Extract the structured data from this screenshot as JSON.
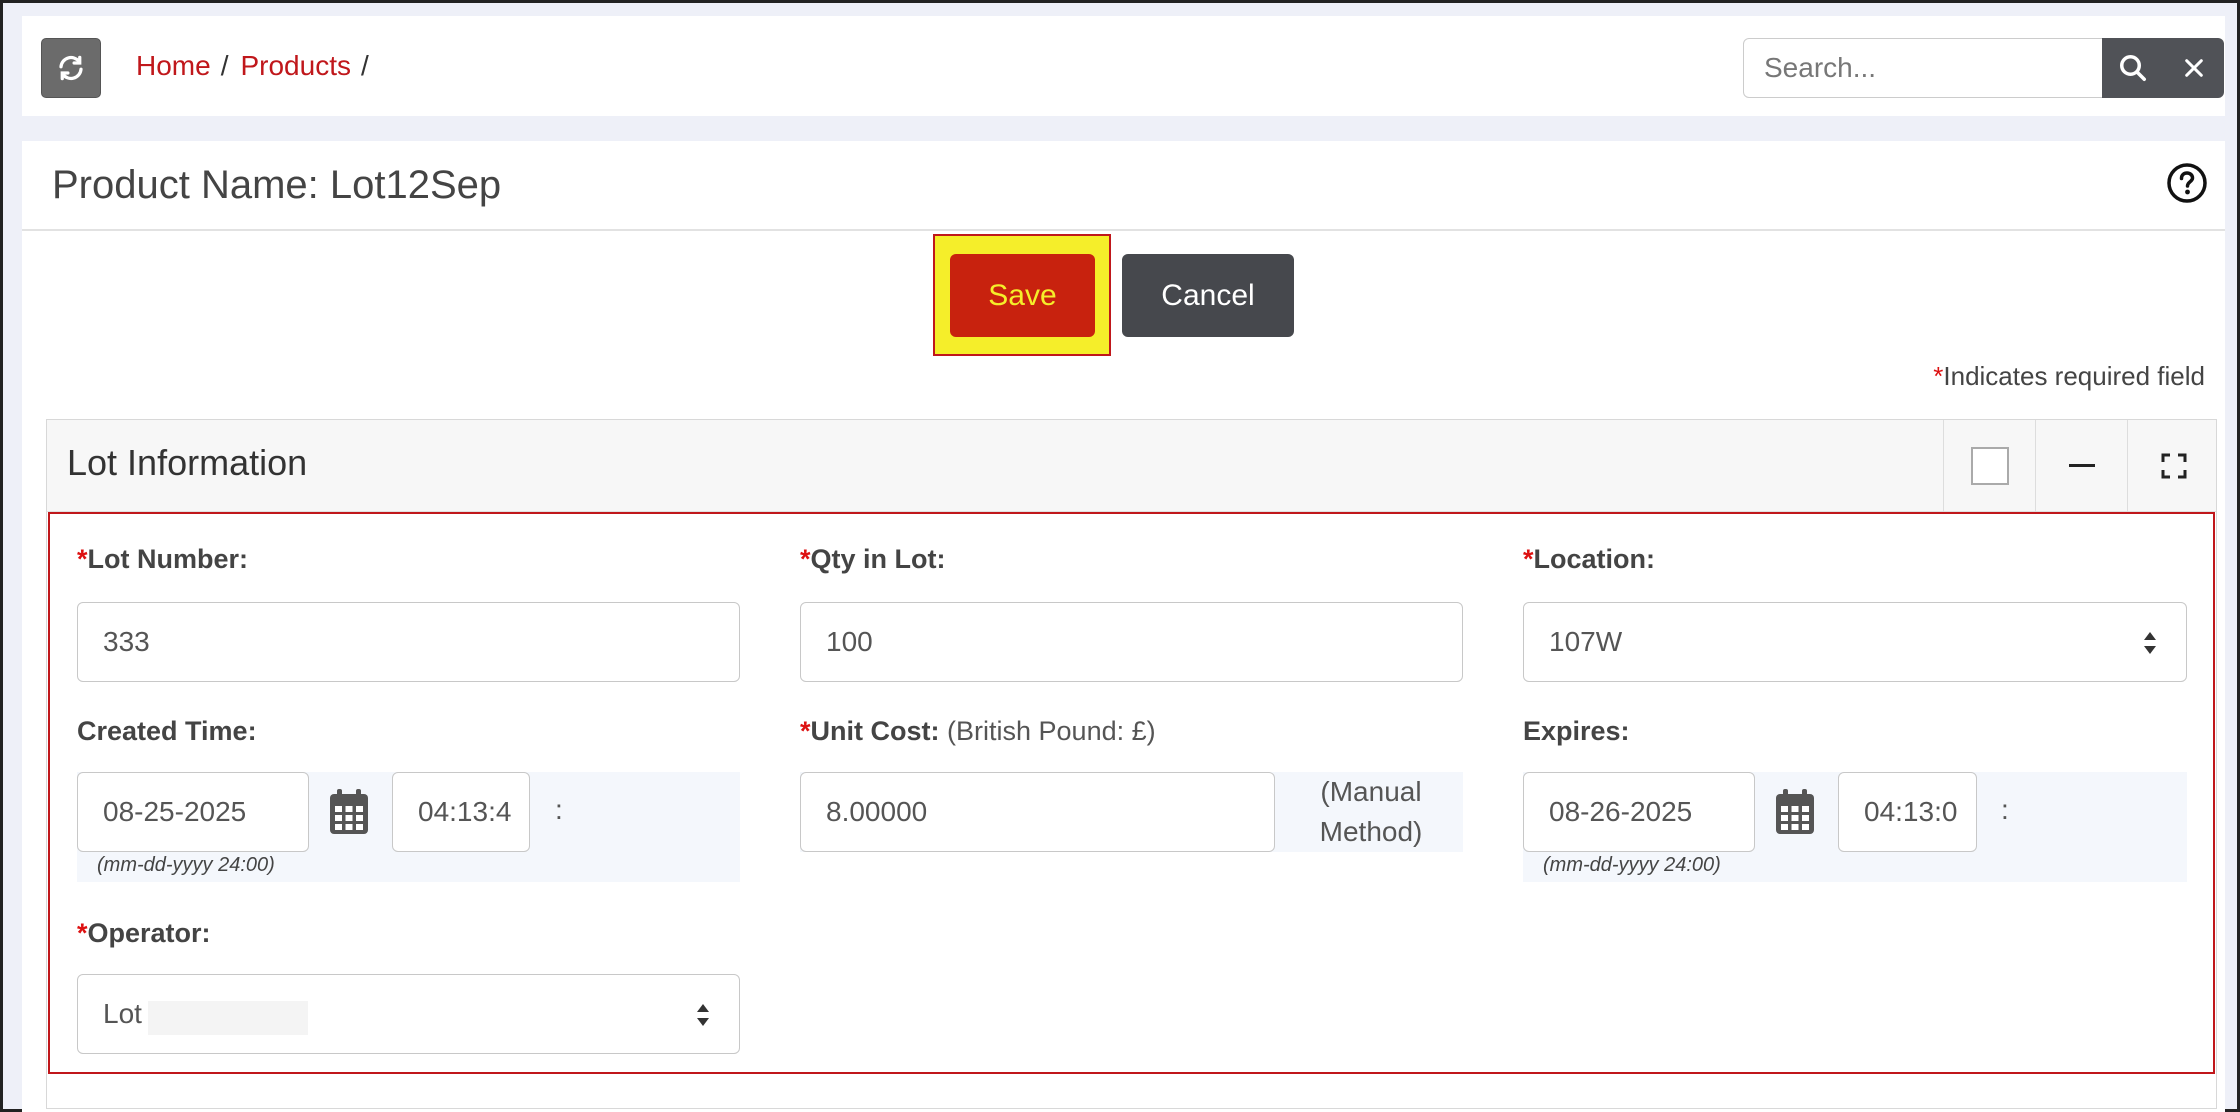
{
  "breadcrumb": {
    "home": "Home",
    "products": "Products",
    "sep": "/"
  },
  "search": {
    "placeholder": "Search..."
  },
  "page": {
    "title": "Product Name: Lot12Sep"
  },
  "actions": {
    "save": "Save",
    "cancel": "Cancel"
  },
  "required_note": {
    "star": "*",
    "text": "Indicates required field"
  },
  "section": {
    "title": "Lot Information"
  },
  "form": {
    "lot_number": {
      "star": "*",
      "label": "Lot Number:",
      "value": "333"
    },
    "qty_in_lot": {
      "star": "*",
      "label": "Qty in Lot:",
      "value": "100"
    },
    "location": {
      "star": "*",
      "label": "Location:",
      "value": "107W"
    },
    "created_time": {
      "label": "Created Time:",
      "date": "08-25-2025",
      "time": "04:13:4",
      "colon": ":",
      "hint": "(mm-dd-yyyy 24:00)"
    },
    "unit_cost": {
      "star": "*",
      "label": "Unit Cost:",
      "unit": "(British Pound: £)",
      "value": "8.00000",
      "method_line1": "(Manual",
      "method_line2": "Method)"
    },
    "expires": {
      "label": "Expires:",
      "date": "08-26-2025",
      "time": "04:13:0",
      "colon": ":",
      "hint": "(mm-dd-yyyy 24:00)"
    },
    "operator": {
      "star": "*",
      "label": "Operator:",
      "value": "Lot"
    }
  },
  "colors": {
    "accent": "#c0171b",
    "save_bg": "#c8220e",
    "highlight": "#f5ee2a",
    "dark_btn": "#46484d"
  }
}
